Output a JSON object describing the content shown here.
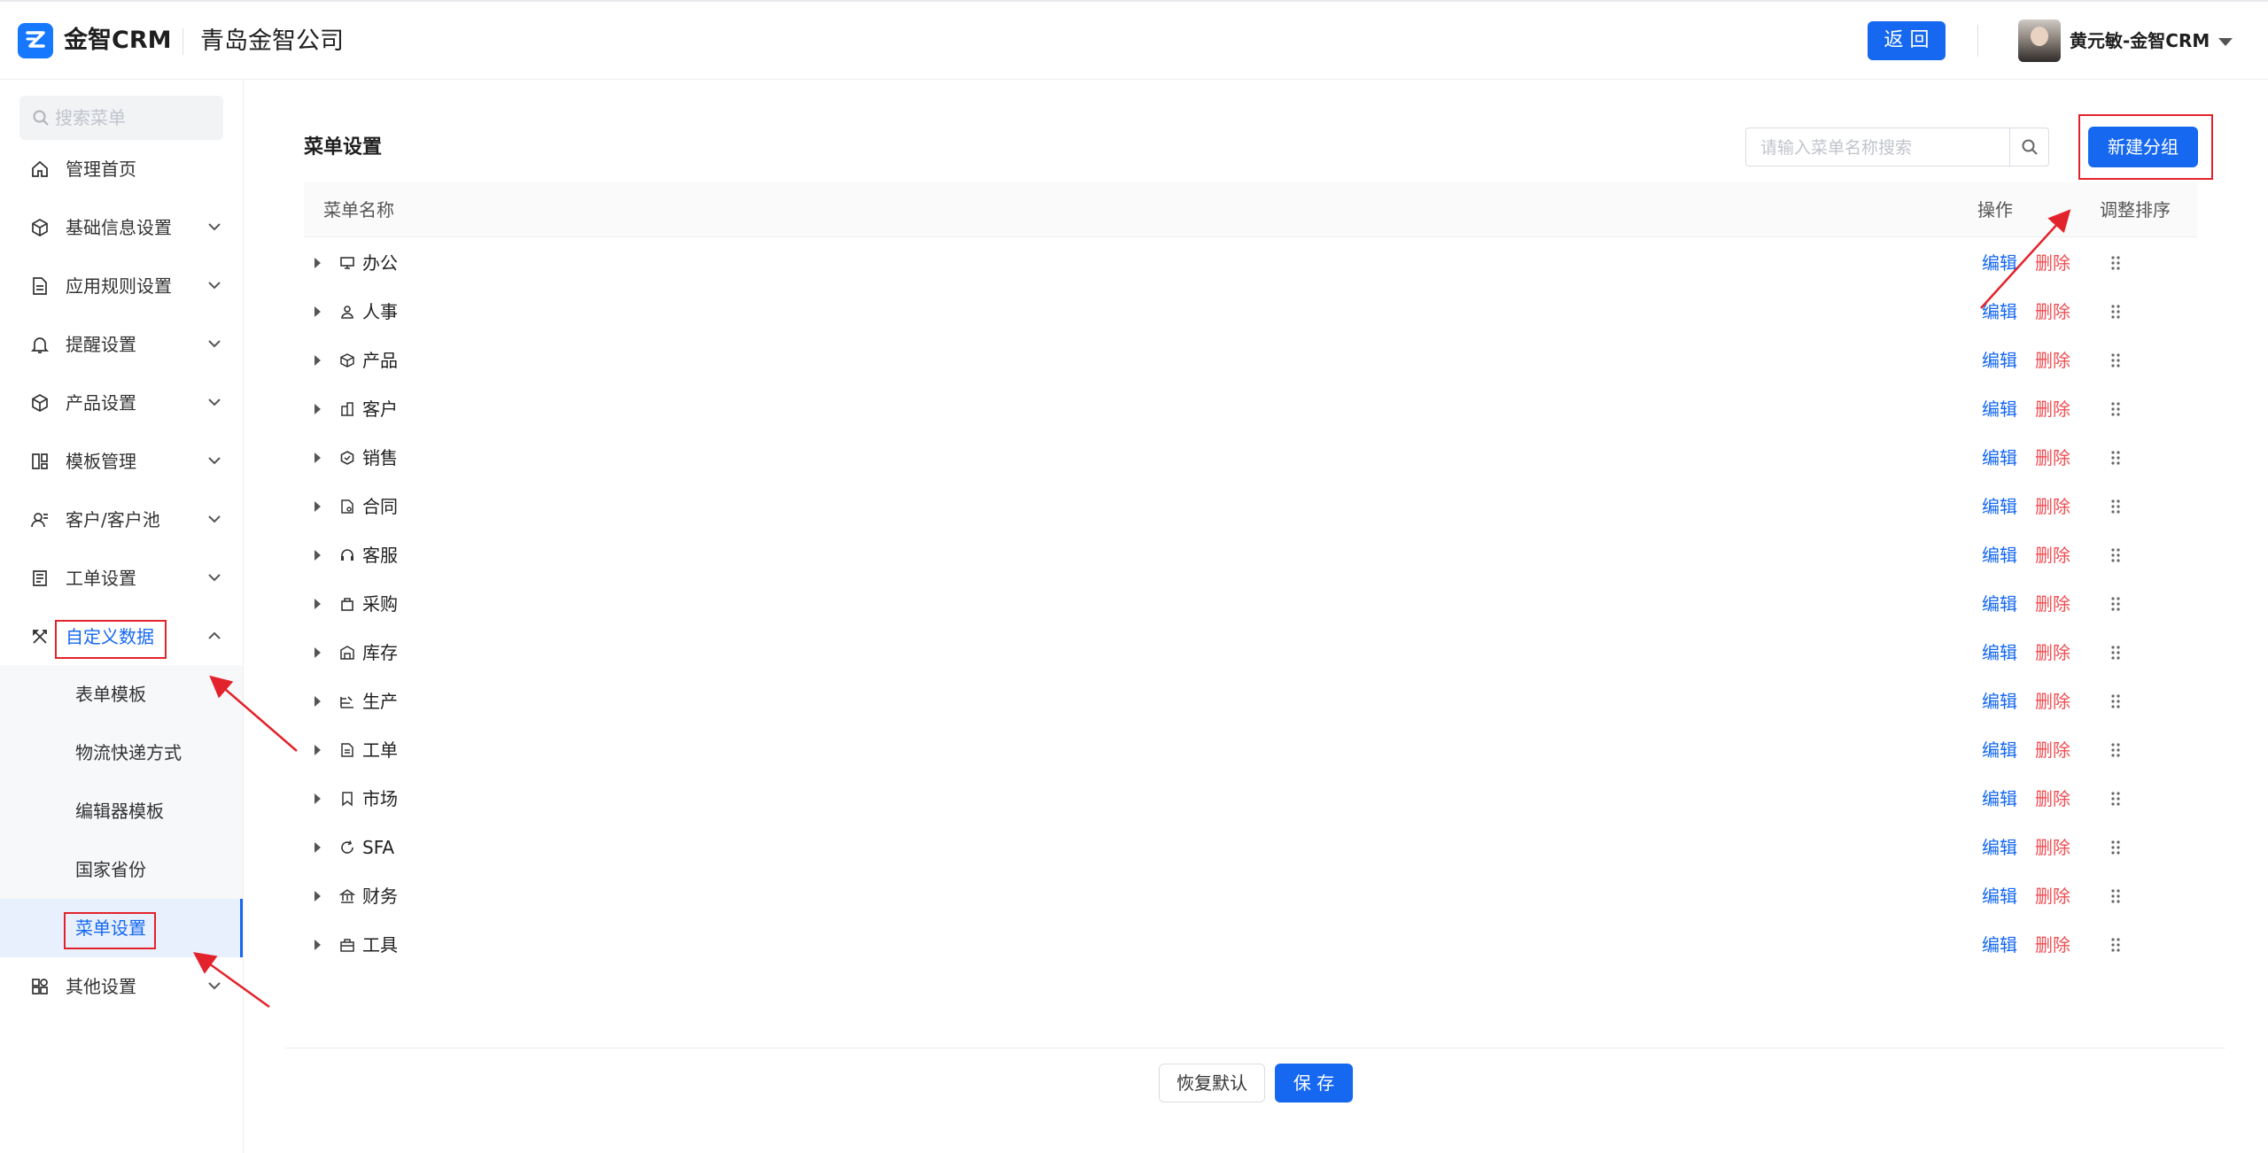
{
  "header": {
    "brand": "金智CRM",
    "company": "青岛金智公司",
    "back_label": "返 回",
    "user_name": "黄元敏-金智CRM"
  },
  "sidebar": {
    "search_placeholder": "搜索菜单",
    "items": [
      {
        "label": "管理首页",
        "icon": "home-icon"
      },
      {
        "label": "基础信息设置",
        "icon": "cube-icon"
      },
      {
        "label": "应用规则设置",
        "icon": "document-icon"
      },
      {
        "label": "提醒设置",
        "icon": "bell-icon"
      },
      {
        "label": "产品设置",
        "icon": "box-icon"
      },
      {
        "label": "模板管理",
        "icon": "template-icon"
      },
      {
        "label": "客户/客户池",
        "icon": "contacts-icon"
      },
      {
        "label": "工单设置",
        "icon": "workorder-icon"
      },
      {
        "label": "自定义数据",
        "icon": "tools-icon"
      },
      {
        "label": "其他设置",
        "icon": "apps-icon"
      }
    ],
    "sub_items": [
      "表单模板",
      "物流快递方式",
      "编辑器模板",
      "国家省份",
      "菜单设置"
    ]
  },
  "main": {
    "title": "菜单设置",
    "search_placeholder": "请输入菜单名称搜索",
    "new_group_label": "新建分组",
    "columns": {
      "name": "菜单名称",
      "actions": "操作",
      "sort": "调整排序"
    },
    "edit_label": "编辑",
    "delete_label": "删除",
    "rows": [
      {
        "name": "办公",
        "icon": "desktop-icon"
      },
      {
        "name": "人事",
        "icon": "person-icon"
      },
      {
        "name": "产品",
        "icon": "product-box-icon"
      },
      {
        "name": "客户",
        "icon": "building-icon"
      },
      {
        "name": "销售",
        "icon": "hexagon-icon"
      },
      {
        "name": "合同",
        "icon": "contract-icon"
      },
      {
        "name": "客服",
        "icon": "headset-icon"
      },
      {
        "name": "采购",
        "icon": "bag-icon"
      },
      {
        "name": "库存",
        "icon": "warehouse-icon"
      },
      {
        "name": "生产",
        "icon": "factory-icon"
      },
      {
        "name": "工单",
        "icon": "file-icon"
      },
      {
        "name": "市场",
        "icon": "flag-icon"
      },
      {
        "name": "SFA",
        "icon": "refresh-icon"
      },
      {
        "name": "财务",
        "icon": "bank-icon"
      },
      {
        "name": "工具",
        "icon": "toolbox-icon"
      }
    ],
    "reset_label": "恢复默认",
    "save_label": "保 存"
  },
  "colors": {
    "primary": "#1668f0",
    "danger": "#f04d52",
    "annotation": "#e3232b"
  }
}
